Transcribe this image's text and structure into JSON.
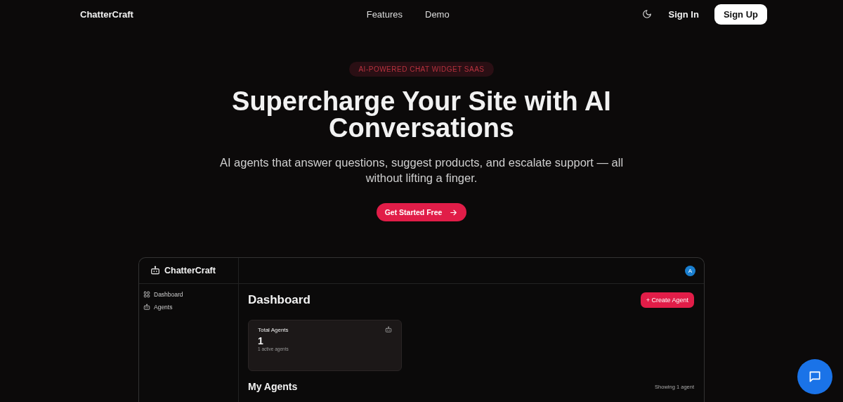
{
  "nav": {
    "brand": "ChatterCraft",
    "links": [
      "Features",
      "Demo"
    ],
    "sign_in": "Sign In",
    "sign_up": "Sign Up"
  },
  "hero": {
    "badge": "AI-POWERED CHAT WIDGET SAAS",
    "title": "Supercharge Your Site with AI Conversations",
    "subtitle": "AI agents that answer questions, suggest products, and escalate support — all without lifting a finger.",
    "cta": "Get Started Free"
  },
  "dashboard": {
    "brand": "ChatterCraft",
    "avatar": "A",
    "sidebar": {
      "items": [
        {
          "label": "Dashboard",
          "kind": "grid"
        },
        {
          "label": "Agents",
          "kind": "bot"
        }
      ]
    },
    "title": "Dashboard",
    "create_button": "+ Create Agent",
    "stat_card": {
      "label": "Total Agents",
      "value": "1",
      "note": "1 active agents"
    },
    "section_title": "My Agents",
    "section_note": "Showing 1 agent"
  }
}
